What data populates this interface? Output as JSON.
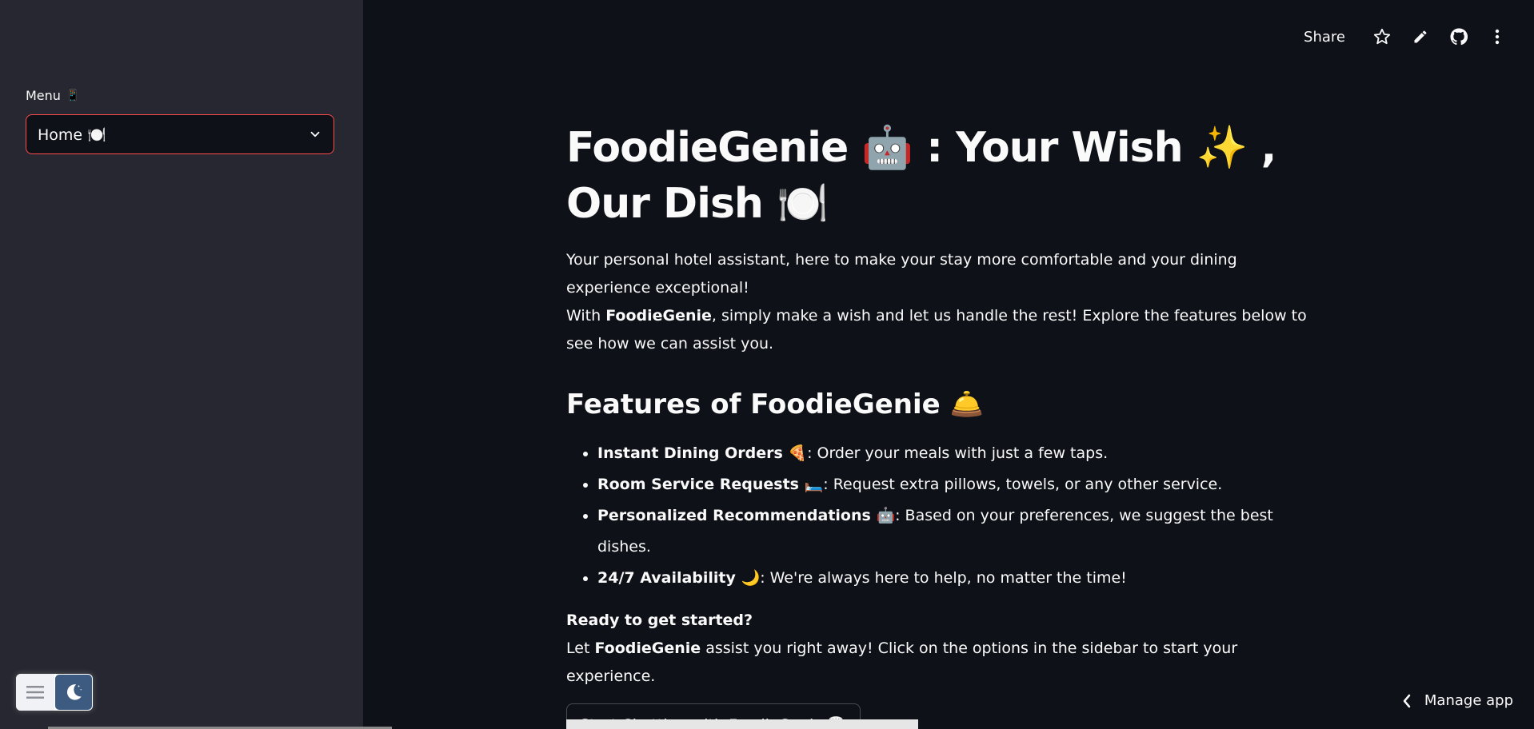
{
  "sidebar": {
    "menu_label": "Menu",
    "menu_icon": "📱",
    "select_value": "Home 🍽️",
    "select_icon": "chevron-down-icon"
  },
  "toolbar": {
    "share_label": "Share",
    "icons": [
      "star-icon",
      "edit-pencil-icon",
      "github-icon",
      "more-vertical-icon"
    ]
  },
  "main": {
    "title": "FoodieGenie 🤖 : Your Wish ✨ , Our Dish 🍽️",
    "intro_line1": "Your personal hotel assistant, here to make your stay more comfortable and your dining experience exceptional!",
    "intro_line2_prefix": "With ",
    "intro_line2_bold": "FoodieGenie",
    "intro_line2_suffix": ", simply make a wish and let us handle the rest! Explore the features below to see how we can assist you.",
    "features_heading": "Features of FoodieGenie 🛎️",
    "features": [
      {
        "bold": "Instant Dining Orders 🍕",
        "text": ": Order your meals with just a few taps."
      },
      {
        "bold": "Room Service Requests 🛏️",
        "text": ": Request extra pillows, towels, or any other service."
      },
      {
        "bold": "Personalized Recommendations 🤖",
        "text": ": Based on your preferences, we suggest the best dishes."
      },
      {
        "bold": "24/7 Availability 🌙",
        "text": ": We're always here to help, no matter the time!"
      }
    ],
    "ready_heading": "Ready to get started?",
    "ready_prefix": "Let ",
    "ready_bold": "FoodieGenie",
    "ready_suffix": " assist you right away! Click on the options in the sidebar to start your experience.",
    "start_button": "Start Chatting with FoodieGenie 🧑‍🍳"
  },
  "footer": {
    "manage_app": "Manage app"
  },
  "colors": {
    "background": "#0e1117",
    "sidebar": "#262730",
    "accent": "#ff4b4b",
    "text": "#fafafa"
  }
}
